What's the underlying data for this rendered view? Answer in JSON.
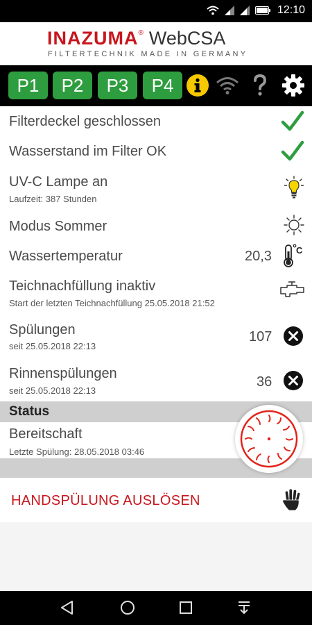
{
  "status_bar": {
    "time": "12:10",
    "icons": [
      "wifi-icon",
      "signal-icon",
      "signal-icon",
      "battery-icon"
    ]
  },
  "brand": {
    "logo": "INAZUMA",
    "registered": "®",
    "product": "WebCSA",
    "tagline": "FILTERTECHNIK MADE IN GERMANY"
  },
  "toolbar": {
    "programs": [
      "P1",
      "P2",
      "P3",
      "P4"
    ],
    "program_color": "#2e9d3f",
    "icons": [
      "info-icon",
      "wifi-icon",
      "help-icon",
      "settings-gear-icon"
    ],
    "info_color": "#f5c800"
  },
  "status_items": [
    {
      "title": "Filterdeckel geschlossen",
      "icon": "checkmark-icon"
    },
    {
      "title": "Wasserstand im Filter OK",
      "icon": "checkmark-icon"
    },
    {
      "title": "UV-C Lampe an",
      "subtitle": "Laufzeit: 387 Stunden",
      "icon": "lightbulb-on-icon"
    },
    {
      "title": "Modus Sommer",
      "icon": "sun-icon"
    },
    {
      "title": "Wassertemperatur",
      "value": "20,3",
      "icon": "thermometer-celsius-icon"
    },
    {
      "title": "Teichnachfüllung inaktiv",
      "subtitle": "Start der letzten Teichnachfüllung 25.05.2018 21:52",
      "icon": "water-tap-icon"
    },
    {
      "title": "Spülungen",
      "subtitle": "seit 25.05.2018 22:13",
      "value": "107",
      "icon": "reset-x-icon"
    },
    {
      "title": "Rinnenspülungen",
      "subtitle": "seit 25.05.2018 22:13",
      "value": "36",
      "icon": "reset-x-icon"
    }
  ],
  "status_section": {
    "header": "Status",
    "state": "Bereitschaft",
    "last_flush": "Letzte Spülung: 28.05.2018 03:46",
    "gauge_icon": "flush-gauge-icon"
  },
  "manual_flush": {
    "label": "HANDSPÜLUNG AUSLÖSEN",
    "icon": "hand-icon"
  },
  "colors": {
    "accent_red": "#c8161d",
    "check_green": "#2e9d3f",
    "section_gray": "#cfcfcf"
  },
  "nav_bar": {
    "icons": [
      "back-icon",
      "home-icon",
      "recents-icon",
      "notifications-pull-icon"
    ]
  }
}
